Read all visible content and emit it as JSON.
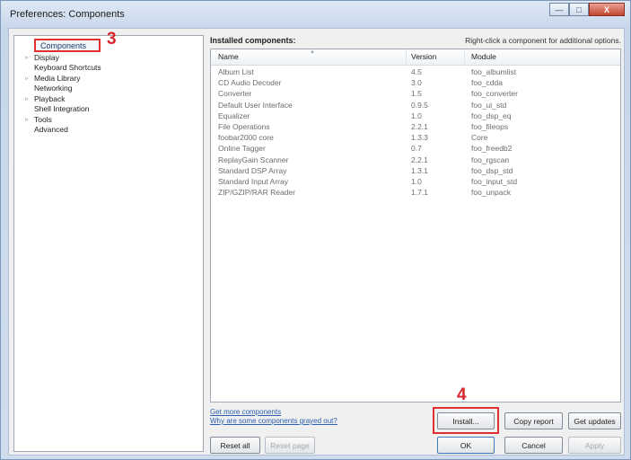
{
  "window": {
    "title": "Preferences: Components",
    "controls": {
      "minimize": "—",
      "maximize": "□",
      "close": "X"
    }
  },
  "tree": {
    "items": [
      {
        "label": "Components",
        "selected": true
      },
      {
        "label": "Display",
        "expandable": true
      },
      {
        "label": "Keyboard Shortcuts"
      },
      {
        "label": "Media Library",
        "expandable": true
      },
      {
        "label": "Networking"
      },
      {
        "label": "Playback",
        "expandable": true
      },
      {
        "label": "Shell Integration"
      },
      {
        "label": "Tools",
        "expandable": true
      },
      {
        "label": "Advanced"
      }
    ]
  },
  "annotations": {
    "step_components": "3",
    "step_install": "4"
  },
  "components": {
    "heading": "Installed components:",
    "hint": "Right-click a component for additional options.",
    "columns": {
      "name": "Name",
      "version": "Version",
      "module": "Module"
    },
    "rows": [
      {
        "name": "Album List",
        "version": "4.5",
        "module": "foo_albumlist"
      },
      {
        "name": "CD Audio Decoder",
        "version": "3.0",
        "module": "foo_cdda"
      },
      {
        "name": "Converter",
        "version": "1.5",
        "module": "foo_converter"
      },
      {
        "name": "Default User Interface",
        "version": "0.9.5",
        "module": "foo_ui_std"
      },
      {
        "name": "Equalizer",
        "version": "1.0",
        "module": "foo_dsp_eq"
      },
      {
        "name": "File Operations",
        "version": "2.2.1",
        "module": "foo_fileops"
      },
      {
        "name": "foobar2000 core",
        "version": "1.3.3",
        "module": "Core"
      },
      {
        "name": "Online Tagger",
        "version": "0.7",
        "module": "foo_freedb2"
      },
      {
        "name": "ReplayGain Scanner",
        "version": "2.2.1",
        "module": "foo_rgscan"
      },
      {
        "name": "Standard DSP Array",
        "version": "1.3.1",
        "module": "foo_dsp_std"
      },
      {
        "name": "Standard Input Array",
        "version": "1.0",
        "module": "foo_input_std"
      },
      {
        "name": "ZIP/GZIP/RAR Reader",
        "version": "1.7.1",
        "module": "foo_unpack"
      }
    ]
  },
  "links": {
    "get_more": "Get more components",
    "why_grayed": "Why are some components grayed out?"
  },
  "buttons": {
    "install": "Install...",
    "copy_report": "Copy report",
    "get_updates": "Get updates",
    "reset_all": "Reset all",
    "reset_page": "Reset page",
    "ok": "OK",
    "cancel": "Cancel",
    "apply": "Apply"
  },
  "colors": {
    "annotation_red": "#e03030",
    "link_blue": "#2c5fb0"
  }
}
